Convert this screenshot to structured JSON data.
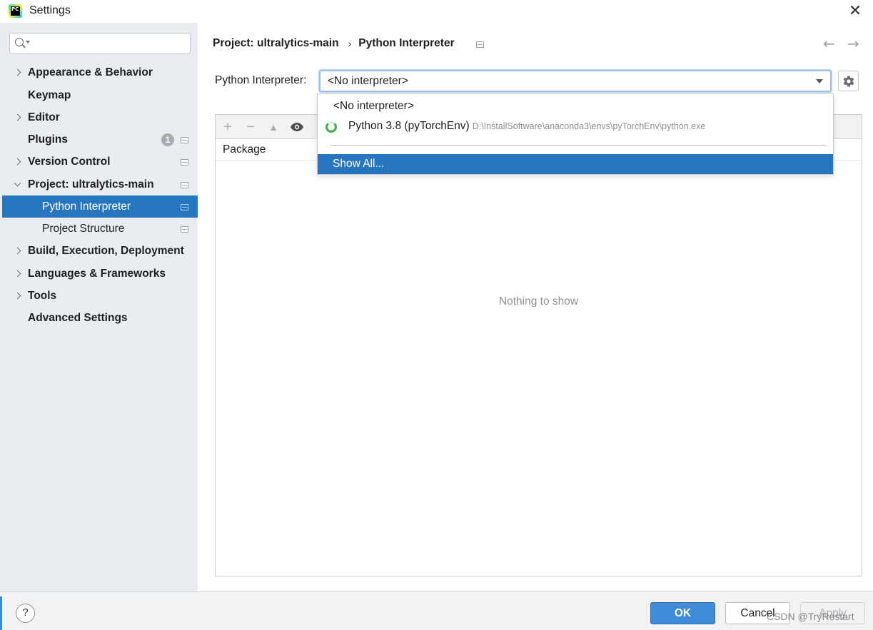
{
  "window": {
    "title": "Settings",
    "close_glyph": "✕"
  },
  "search": {
    "placeholder": "",
    "value": ""
  },
  "sidebar": {
    "items": [
      {
        "label": "Appearance & Behavior"
      },
      {
        "label": "Keymap"
      },
      {
        "label": "Editor"
      },
      {
        "label": "Plugins",
        "badge": "1"
      },
      {
        "label": "Version Control"
      },
      {
        "label": "Project: ultralytics-main"
      },
      {
        "label": "Python Interpreter",
        "selected": true
      },
      {
        "label": "Project Structure"
      },
      {
        "label": "Build, Execution, Deployment"
      },
      {
        "label": "Languages & Frameworks"
      },
      {
        "label": "Tools"
      },
      {
        "label": "Advanced Settings"
      }
    ]
  },
  "breadcrumb": {
    "parent": "Project: ultralytics-main",
    "separator": "›",
    "current": "Python Interpreter"
  },
  "nav": {
    "back": "←",
    "forward": "→"
  },
  "interpreter": {
    "label": "Python Interpreter:",
    "value": "<No interpreter>"
  },
  "dropdown": {
    "options": [
      {
        "label": "<No interpreter>"
      },
      {
        "label": "Python 3.8 (pyTorchEnv)",
        "path": "D:\\InstallSoftware\\anaconda3\\envs\\pyTorchEnv\\python.exe",
        "icon": "conda-spinner-icon"
      },
      {
        "label": "Show All...",
        "highlighted": true
      }
    ]
  },
  "packages": {
    "toolbar": {
      "add": "+",
      "remove": "−",
      "up": "▲"
    },
    "columns": [
      "Package"
    ],
    "empty_text": "Nothing to show"
  },
  "footer": {
    "help": "?",
    "ok": "OK",
    "cancel": "Cancel",
    "apply": "Apply"
  },
  "watermark": "CSDN @TryRestart",
  "colors": {
    "accent": "#2675bf",
    "sidebar_bg": "#e9edf1",
    "ok_button": "#3f8bd8",
    "spinner": "#37b24d"
  },
  "logo_text": "PC"
}
